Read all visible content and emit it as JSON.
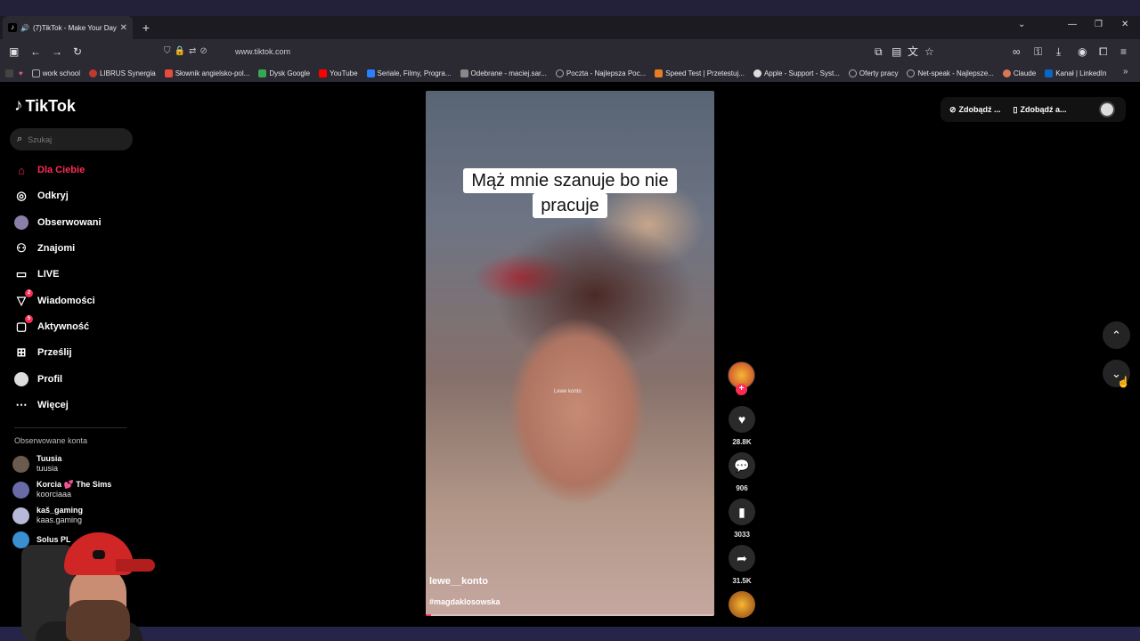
{
  "browser": {
    "tab_title": "(7)TikTok - Make Your Day",
    "url": "www.tiktok.com",
    "bookmarks": [
      {
        "label": "",
        "color": "#e05a7a"
      },
      {
        "label": "work school",
        "color": "#777777"
      },
      {
        "label": "LIBRUS Synergia",
        "color": "#c0392b"
      },
      {
        "label": "Słownik angielsko-pol...",
        "color": "#e74c3c"
      },
      {
        "label": "Dysk Google",
        "color": "#34a853"
      },
      {
        "label": "YouTube",
        "color": "#ff0000"
      },
      {
        "label": "Seriale, Filmy, Progra...",
        "color": "#2a7fff"
      },
      {
        "label": "Odebrane - maciej.sar...",
        "color": "#888888"
      },
      {
        "label": "Poczta - Najlepsza Poc...",
        "color": "#aaaaaa"
      },
      {
        "label": "Speed Test | Przetestuj...",
        "color": "#e67e22"
      },
      {
        "label": "Apple - Support - Syst...",
        "color": "#dddddd"
      },
      {
        "label": "Oferty pracy",
        "color": "#aaaaaa"
      },
      {
        "label": "Net-speak - Najlepsze...",
        "color": "#aaaaaa"
      },
      {
        "label": "Claude",
        "color": "#d97757"
      },
      {
        "label": "Kanał | LinkedIn",
        "color": "#0a66c2"
      }
    ]
  },
  "tiktok": {
    "logo": "TikTok",
    "search_placeholder": "Szukaj",
    "nav": [
      {
        "label": "Dla Ciebie",
        "icon": "home-icon",
        "active": true
      },
      {
        "label": "Odkryj",
        "icon": "compass-icon"
      },
      {
        "label": "Obserwowani",
        "icon": "following-avatar-icon"
      },
      {
        "label": "Znajomi",
        "icon": "friends-icon"
      },
      {
        "label": "LIVE",
        "icon": "live-tv-icon"
      },
      {
        "label": "Wiadomości",
        "icon": "messages-icon",
        "badge": "2"
      },
      {
        "label": "Aktywność",
        "icon": "activity-icon",
        "badge": "5"
      },
      {
        "label": "Prześlij",
        "icon": "upload-icon"
      },
      {
        "label": "Profil",
        "icon": "profile-avatar-icon"
      },
      {
        "label": "Więcej",
        "icon": "more-icon"
      }
    ],
    "followed_title": "Obserwowane konta",
    "followed": [
      {
        "name": "Tuusia",
        "handle": "tuusia",
        "color": "#6b5a4e"
      },
      {
        "name": "Korcia 💕 The Sims",
        "handle": "koorciaaa",
        "color": "#6a6aa8"
      },
      {
        "name": "kaš_gaming",
        "handle": "kaas.gaming",
        "color": "#b8b8d8"
      },
      {
        "name": "Solus PL",
        "handle": "",
        "color": "#3a8fd0"
      }
    ],
    "top_right": {
      "get_coins": "Zdobądź ...",
      "get_app": "Zdobądź a..."
    },
    "video": {
      "caption_line1": "Mąż mnie szanuje bo nie",
      "caption_line2": "pracuje",
      "watermark": "Lewe konto",
      "username": "lewe__konto",
      "hashtag": "#magdaklosowska",
      "progress": 0.02
    },
    "actions": {
      "likes": "28.8K",
      "comments": "906",
      "saves": "3033",
      "shares": "31.5K"
    }
  }
}
